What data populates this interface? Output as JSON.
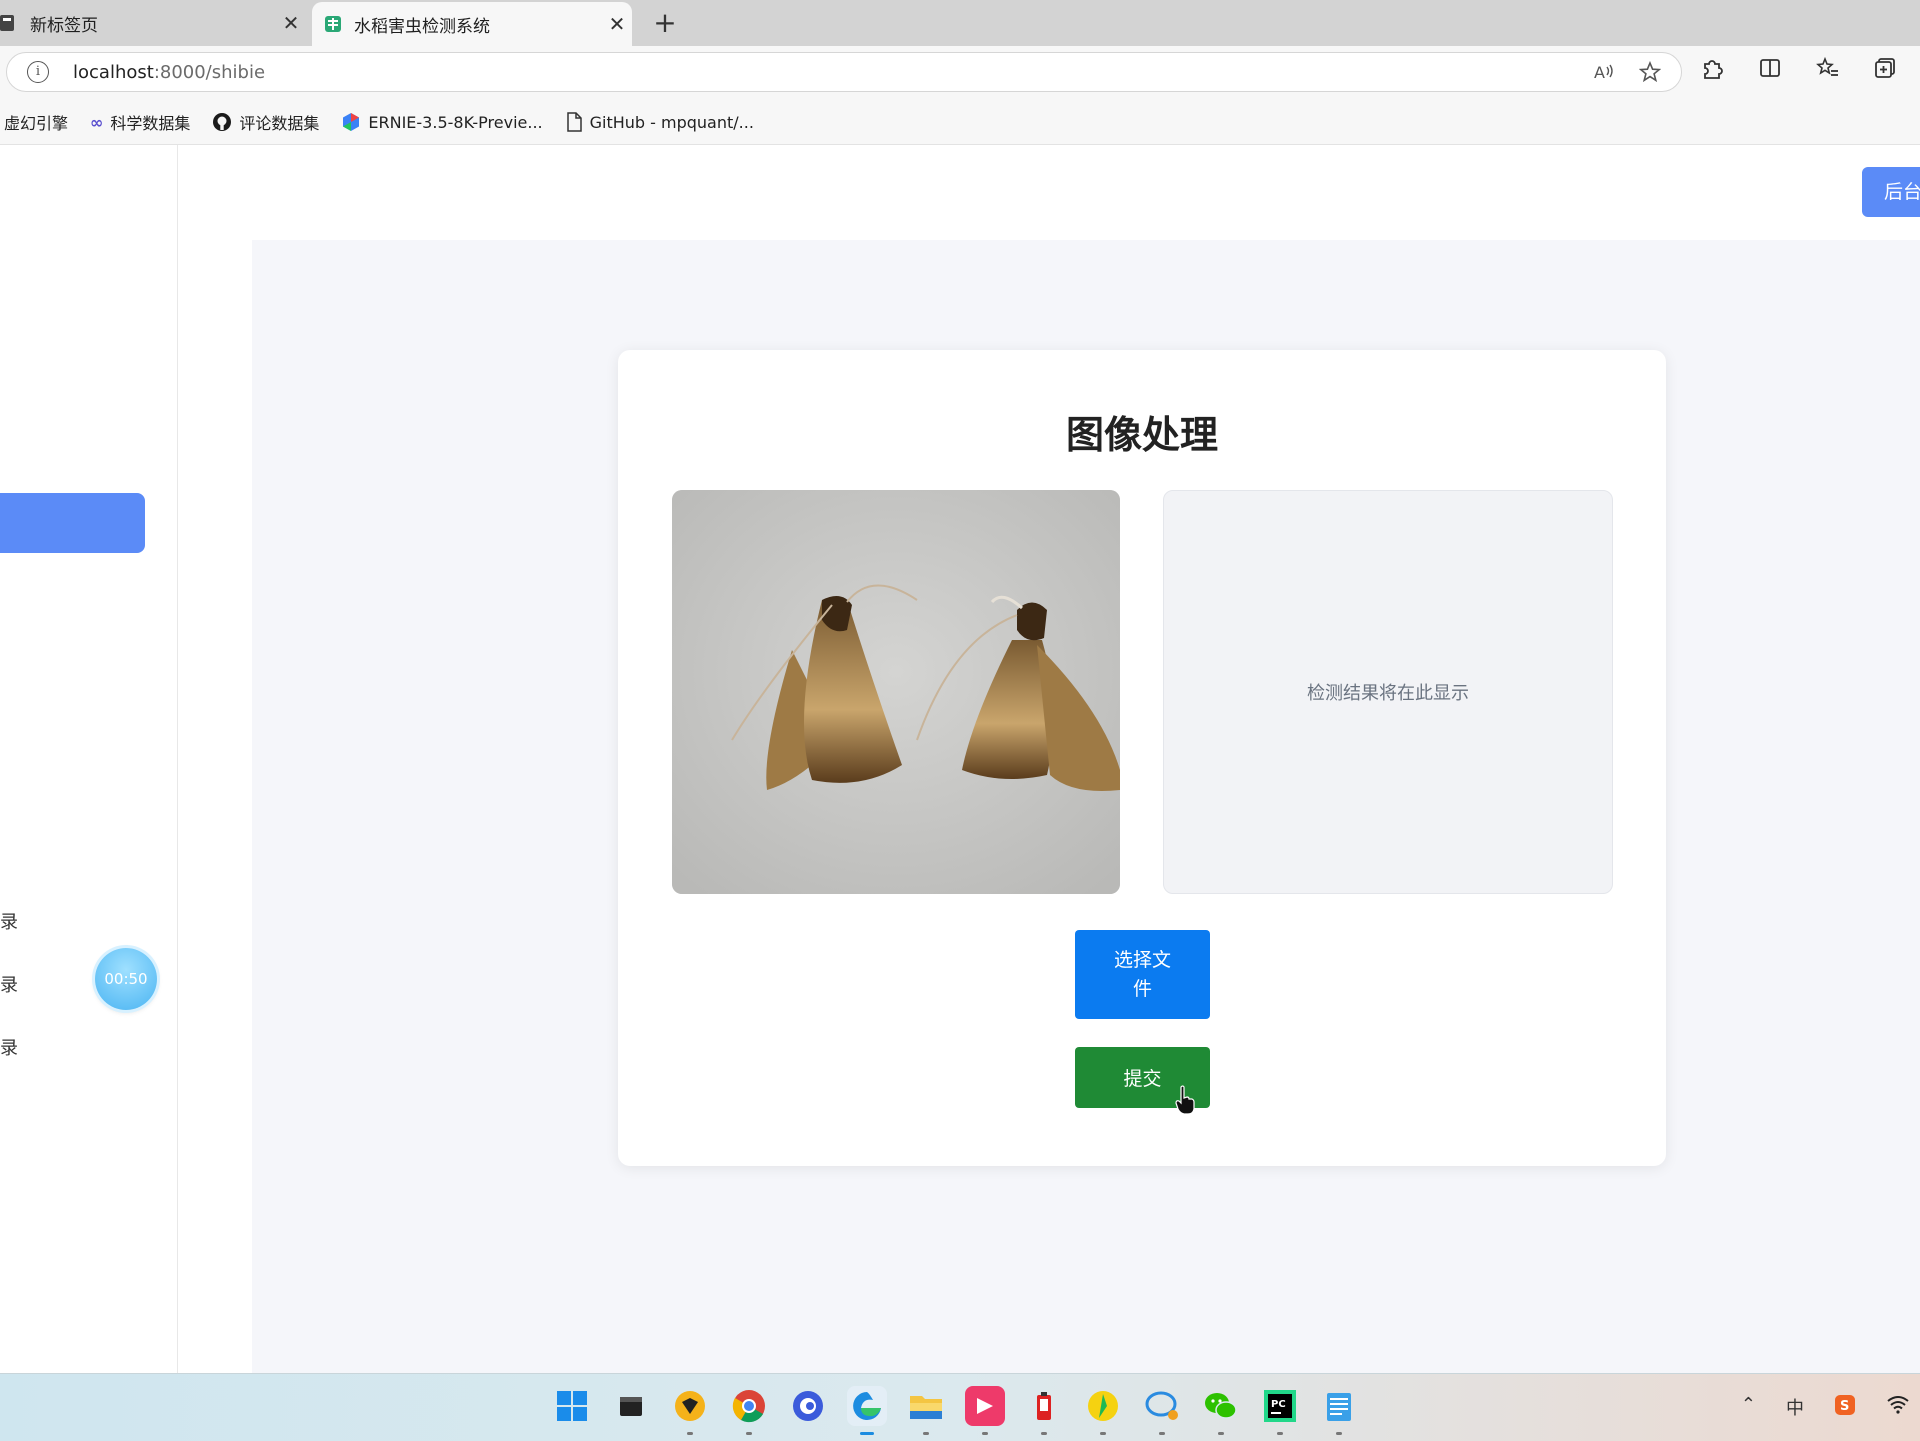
{
  "browser": {
    "tabs": [
      {
        "title": "新标签页",
        "active": false
      },
      {
        "title": "水稻害虫检测系统",
        "active": true
      }
    ],
    "new_tab_symbol": "+",
    "close_symbol": "✕",
    "url_host": "localhost",
    "url_rest": ":8000/shibie",
    "bookmarks": [
      {
        "label": "虚幻引擎",
        "icon": "none"
      },
      {
        "label": "科学数据集",
        "icon": "infinity-icon"
      },
      {
        "label": "评论数据集",
        "icon": "github-icon"
      },
      {
        "label": "ERNIE-3.5-8K-Previe...",
        "icon": "ernie-icon"
      },
      {
        "label": "GitHub - mpquant/...",
        "icon": "document-icon"
      }
    ]
  },
  "app": {
    "header": {
      "admin_button": "后台"
    },
    "sidebar": {
      "items": [
        "录",
        "录",
        "录"
      ],
      "timer": "00:50"
    },
    "card": {
      "title": "图像处理",
      "result_placeholder": "检测结果将在此显示",
      "select_file_button": "选择文件",
      "submit_button": "提交"
    }
  },
  "taskbar": {
    "icons": [
      "windows-start-icon",
      "file-icon",
      "shield-app-icon",
      "chrome-icon",
      "browser-blue-icon",
      "edge-icon",
      "file-explorer-icon",
      "media-app-icon",
      "battery-app-icon",
      "music-app-icon",
      "chat-app-icon",
      "wechat-icon",
      "pycharm-icon",
      "notepad-icon"
    ],
    "tray_ime": "中"
  },
  "colors": {
    "accent_blue": "#5b8bf7",
    "select_button": "#0b7bf0",
    "submit_button": "#1f8a35"
  }
}
